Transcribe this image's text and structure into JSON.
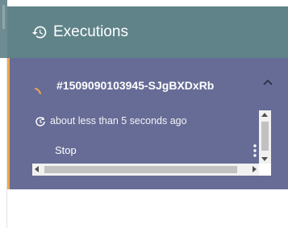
{
  "panel": {
    "title": "Executions",
    "colors": {
      "header_bg": "#5f8389",
      "card_bg": "#676c96",
      "accent": "#f0a64a"
    }
  },
  "execution": {
    "id": "#1509090103945-SJgBXDxRb",
    "status_icon": "spinner-icon",
    "time": "about less than 5 seconds ago",
    "stop_label": "Stop"
  }
}
